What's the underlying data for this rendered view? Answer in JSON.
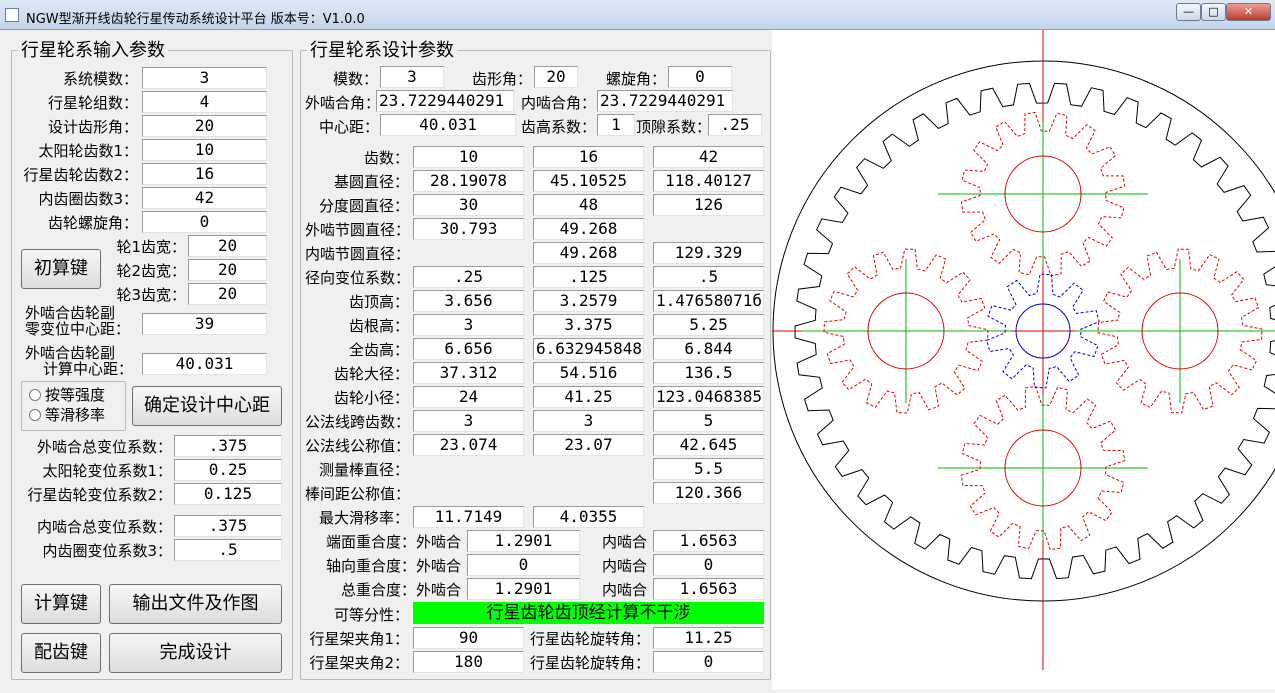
{
  "window": {
    "title": "NGW型渐开线齿轮行星传动系统设计平台  版本号：V1.0.0",
    "min": "—",
    "max": "□",
    "close": "✕"
  },
  "left": {
    "title": "行星轮系输入参数",
    "fields": [
      {
        "label": "系统模数：",
        "value": "3"
      },
      {
        "label": "行星轮组数：",
        "value": "4"
      },
      {
        "label": "设计齿形角：",
        "value": "20"
      },
      {
        "label": "太阳轮齿数1：",
        "value": "10"
      },
      {
        "label": "行星齿轮齿数2：",
        "value": "16"
      },
      {
        "label": "内齿圈齿数3：",
        "value": "42"
      },
      {
        "label": "齿轮螺旋角：",
        "value": "0"
      }
    ],
    "chusuan": "初算键",
    "widths": [
      {
        "label": "轮1齿宽：",
        "value": "20"
      },
      {
        "label": "轮2齿宽：",
        "value": "20"
      },
      {
        "label": "轮3齿宽：",
        "value": "20"
      }
    ],
    "zero_label_1": "外啮合齿轮副",
    "zero_label_2": "零变位中心距：",
    "zero_value": "39",
    "calc_label_1": "外啮合齿轮副",
    "calc_label_2": "计算中心距：",
    "calc_value": "40.031",
    "radio1": "按等强度",
    "radio2": "等滑移率",
    "confirm": "确定设计中心距",
    "shifts": [
      {
        "label": "外啮合总变位系数：",
        "value": ".375"
      },
      {
        "label": "太阳轮变位系数1：",
        "value": "0.25"
      },
      {
        "label": "行星齿轮变位系数2：",
        "value": "0.125"
      },
      {
        "label": "内啮合总变位系数：",
        "value": ".375"
      },
      {
        "label": "内齿圈变位系数3：",
        "value": ".5"
      }
    ],
    "calc_btn": "计算键",
    "output_btn": "输出文件及作图",
    "match_btn": "配齿键",
    "finish_btn": "完成设计"
  },
  "mid": {
    "title": "行星轮系设计参数",
    "modulus_label": "模数：",
    "modulus": "3",
    "angle_label": "齿形角：",
    "angle": "20",
    "helix_label": "螺旋角：",
    "helix": "0",
    "ext_angle_label": "外啮合角：",
    "ext_angle": "23.7229440291",
    "int_angle_label": "内啮合角：",
    "int_angle": "23.7229440291",
    "center_label": "中心距：",
    "center": "40.031",
    "addendum_label": "齿高系数：",
    "addendum": "1",
    "clear_label": "顶隙系数：",
    "clear": ".25",
    "rows": [
      {
        "label": "齿数：",
        "v1": "10",
        "v2": "16",
        "v3": "42"
      },
      {
        "label": "基圆直径：",
        "v1": "28.19078",
        "v2": "45.10525",
        "v3": "118.40127"
      },
      {
        "label": "分度圆直径：",
        "v1": "30",
        "v2": "48",
        "v3": "126"
      },
      {
        "label": "外啮节圆直径：",
        "v1": "30.793",
        "v2": "49.268"
      },
      {
        "label": "内啮节圆直径：",
        "v2": "49.268",
        "v3": "129.329"
      },
      {
        "label": "径向变位系数：",
        "v1": ".25",
        "v2": ".125",
        "v3": ".5"
      },
      {
        "label": "齿顶高：",
        "v1": "3.656",
        "v2": "3.2579",
        "v3": "1.47658071б"
      },
      {
        "label": "齿根高：",
        "v1": "3",
        "v2": "3.375",
        "v3": "5.25"
      },
      {
        "label": "全齿高：",
        "v1": "6.656",
        "v2": "6.632945848",
        "v3": "6.844"
      },
      {
        "label": "齿轮大径：",
        "v1": "37.312",
        "v2": "54.516",
        "v3": "136.5"
      },
      {
        "label": "齿轮小径：",
        "v1": "24",
        "v2": "41.25",
        "v3": "123.0468385"
      },
      {
        "label": "公法线跨齿数：",
        "v1": "3",
        "v2": "3",
        "v3": "5"
      },
      {
        "label": "公法线公称值：",
        "v1": "23.074",
        "v2": "23.07",
        "v3": "42.645"
      },
      {
        "label": "测量棒直径：",
        "v3": "5.5"
      },
      {
        "label": "棒间距公称值：",
        "v3": "120.366"
      },
      {
        "label": "最大滑移率：",
        "v1": "11.7149",
        "v2": "4.0355"
      }
    ],
    "overlap": [
      {
        "label": "端面重合度：外啮合",
        "v1": "1.2901",
        "label2": "内啮合",
        "v2": "1.6563"
      },
      {
        "label": "轴向重合度：外啮合",
        "v1": "0",
        "label2": "内啮合",
        "v2": "0"
      },
      {
        "label": "总重合度：外啮合",
        "v1": "1.2901",
        "label2": "内啮合",
        "v2": "1.6563"
      }
    ],
    "div_label": "可等分性：",
    "div_value": "行星齿轮齿顶经计算不干涉",
    "carrier": [
      {
        "label": "行星架夹角1：",
        "v1": "90",
        "label2": "行星齿轮旋转角：",
        "v2": "11.25"
      },
      {
        "label": "行星架夹角2：",
        "v1": "180",
        "label2": "行星齿轮旋转角：",
        "v2": "0"
      }
    ]
  },
  "gear": {
    "z_sun": 10,
    "z_planet": 16,
    "z_ring": 42,
    "planets": 4,
    "colors": {
      "ring": "#000000",
      "planet": "#dd0000",
      "sun": "#0000cc",
      "centerline_red": "#dd0000",
      "centerline_green": "#00bb00"
    }
  }
}
